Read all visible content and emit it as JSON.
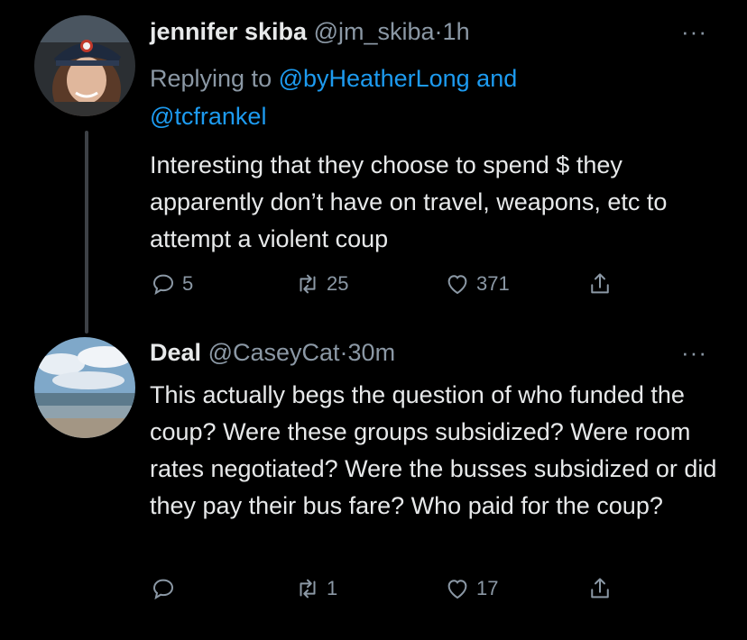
{
  "tweets": [
    {
      "name": "jennifer skiba",
      "handle": "@jm_skiba",
      "separator": "·",
      "time": "1h",
      "replying_prefix": "Replying to",
      "replying_to_1": "@byHeatherLong",
      "replying_and": "and",
      "replying_to_2": "@tcfrankel",
      "text": "Interesting that they choose to spend $ they apparently don’t have on travel, weapons, etc to attempt a violent coup",
      "replies": "5",
      "retweets": "25",
      "likes": "371",
      "more": "···"
    },
    {
      "name": "Deal",
      "handle": "@CaseyCat",
      "separator": "·",
      "time": "30m",
      "text": "This actually begs the question of who funded the coup? Were these groups subsidized? Were room rates negotiated? Were the busses subsidized or did they pay their bus fare? Who paid for the coup?",
      "replies": "",
      "retweets": "1",
      "likes": "17",
      "more": "···"
    }
  ],
  "colors": {
    "background": "#000000",
    "link": "#1d9bf0",
    "muted": "#8b98a5",
    "text": "#e7e9ea"
  },
  "icons": [
    "reply-icon",
    "retweet-icon",
    "like-icon",
    "share-icon",
    "more-icon"
  ]
}
